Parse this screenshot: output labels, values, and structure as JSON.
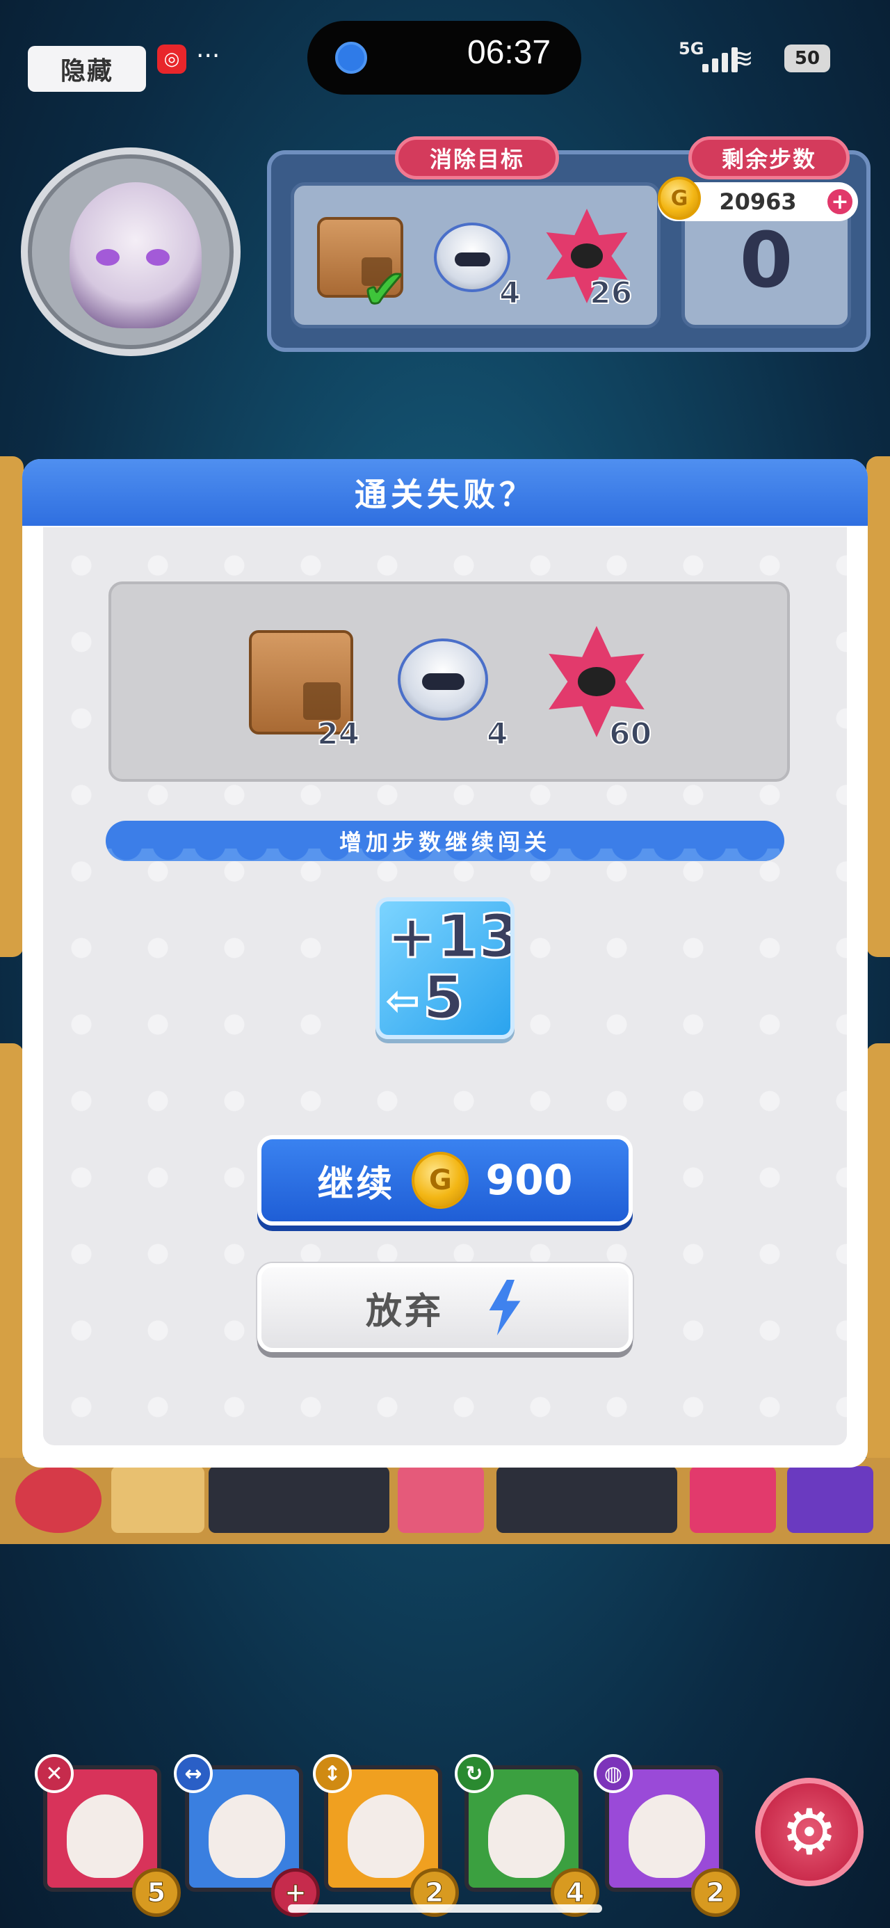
{
  "status_bar": {
    "hide_label": "隐藏",
    "time": "06:37",
    "network": "5G",
    "battery": "50"
  },
  "header": {
    "goal_tab": "消除目标",
    "moves_tab": "剩余步数",
    "coins": "20963",
    "remaining_moves": "0",
    "goals": [
      {
        "icon": "crate-icon",
        "count": "",
        "completed": true
      },
      {
        "icon": "robot-cat-icon",
        "count": "4",
        "completed": false
      },
      {
        "icon": "pink-star-icon",
        "count": "26",
        "completed": false
      }
    ]
  },
  "dialog": {
    "title": "通关失败？",
    "goals": [
      {
        "icon": "crate-icon",
        "count": "24"
      },
      {
        "icon": "robot-cat-icon",
        "count": "4"
      },
      {
        "icon": "pink-star-icon",
        "count": "60"
      }
    ],
    "banner": "增加步数继续闯关",
    "bonus_moves": "+13",
    "bonus_sub": "5",
    "continue_label": "继续",
    "continue_price": "900",
    "giveup_label": "放弃"
  },
  "characters": [
    {
      "skill_icon": "cross-icon",
      "level": "5",
      "color": "#d8335a",
      "skill_color": "#c62b4c"
    },
    {
      "skill_icon": "swap-horizontal-icon",
      "level": "+",
      "color": "#3a7fe0",
      "skill_color": "#2a5fc6"
    },
    {
      "skill_icon": "swap-vertical-icon",
      "level": "2",
      "color": "#f0a020",
      "skill_color": "#d08a12"
    },
    {
      "skill_icon": "refresh-icon",
      "level": "4",
      "color": "#3ba040",
      "skill_color": "#2a8a30"
    },
    {
      "skill_icon": "drop-icon",
      "level": "2",
      "color": "#9a4ad8",
      "skill_color": "#7c34ba"
    }
  ],
  "colors": {
    "primary_blue": "#2f6fe0",
    "accent_pink": "#d43b5c",
    "coin_gold": "#f3b614"
  }
}
